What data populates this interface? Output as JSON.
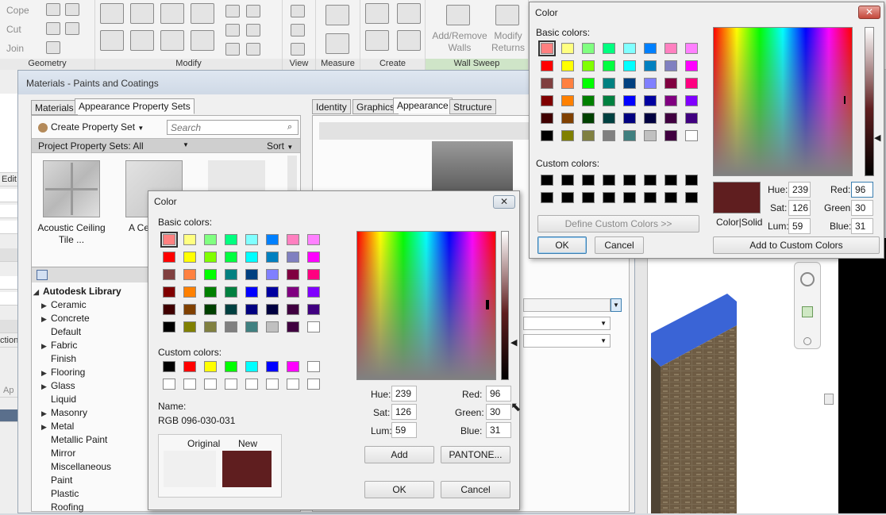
{
  "ribbon": {
    "items": [
      "Cope",
      "Cut",
      "Join"
    ],
    "groups": [
      "Geometry",
      "Modify",
      "View",
      "Measure",
      "Create",
      "Wall Sweep"
    ],
    "wall_sweep_buttons": [
      "Add/Remove Walls",
      "Modify Returns"
    ]
  },
  "left_strip": {
    "labels": [
      "Edit",
      "ction",
      "Ap"
    ]
  },
  "materials": {
    "title": "Materials - Paints and Coatings",
    "left_tabs": [
      "Materials",
      "Appearance Property Sets"
    ],
    "create_set_label": "Create Property Set",
    "search_placeholder": "Search",
    "project_sets": "Project Property Sets: All",
    "sort_label": "Sort",
    "thumbnails": [
      {
        "name": "Acoustic Ceiling Tile ..."
      },
      {
        "name": "A Ceili"
      }
    ],
    "right_tabs": [
      "Identity",
      "Graphics",
      "Appearance",
      "Structure"
    ],
    "library_title": "Autodesk Library",
    "library_items": [
      {
        "label": "Ceramic",
        "expandable": true
      },
      {
        "label": "Concrete",
        "expandable": true
      },
      {
        "label": "Default",
        "expandable": false
      },
      {
        "label": "Fabric",
        "expandable": true
      },
      {
        "label": "Finish",
        "expandable": false
      },
      {
        "label": "Flooring",
        "expandable": true
      },
      {
        "label": "Glass",
        "expandable": true
      },
      {
        "label": "Liquid",
        "expandable": false
      },
      {
        "label": "Masonry",
        "expandable": true
      },
      {
        "label": "Metal",
        "expandable": true
      },
      {
        "label": "Metallic Paint",
        "expandable": false
      },
      {
        "label": "Mirror",
        "expandable": false
      },
      {
        "label": "Miscellaneous",
        "expandable": false
      },
      {
        "label": "Paint",
        "expandable": false
      },
      {
        "label": "Plastic",
        "expandable": false
      },
      {
        "label": "Roofing",
        "expandable": false
      }
    ]
  },
  "basic_colors": [
    [
      "#ff8080",
      "#ffff80",
      "#80ff80",
      "#00ff80",
      "#80ffff",
      "#0080ff",
      "#ff80c0",
      "#ff80ff"
    ],
    [
      "#ff0000",
      "#ffff00",
      "#80ff00",
      "#00ff40",
      "#00ffff",
      "#0080c0",
      "#8080c0",
      "#ff00ff"
    ],
    [
      "#804040",
      "#ff8040",
      "#00ff00",
      "#008080",
      "#004080",
      "#8080ff",
      "#800040",
      "#ff0080"
    ],
    [
      "#800000",
      "#ff8000",
      "#008000",
      "#008040",
      "#0000ff",
      "#0000a0",
      "#800080",
      "#8000ff"
    ],
    [
      "#400000",
      "#804000",
      "#004000",
      "#004040",
      "#000080",
      "#000040",
      "#400040",
      "#400080"
    ],
    [
      "#000000",
      "#808000",
      "#808040",
      "#808080",
      "#408080",
      "#c0c0c0",
      "#400040",
      "#ffffff"
    ]
  ],
  "color_dialog_front": {
    "title": "Color",
    "basic_label": "Basic colors:",
    "custom_label": "Custom colors:",
    "custom_colors": [
      "#000000",
      "#ff0000",
      "#ffff00",
      "#00ff00",
      "#00ffff",
      "#0000ff",
      "#ff00ff",
      "#ffffff",
      "#ffffff",
      "#ffffff",
      "#ffffff",
      "#ffffff",
      "#ffffff",
      "#ffffff",
      "#ffffff",
      "#ffffff"
    ],
    "name_label": "Name:",
    "name_value": "RGB 096-030-031",
    "original_label": "Original",
    "new_label": "New",
    "original_color": "#f0f0f0",
    "new_color": "#5f1e1f",
    "hue_label": "Hue:",
    "hue": "239",
    "sat_label": "Sat:",
    "sat": "126",
    "lum_label": "Lum:",
    "lum": "59",
    "red_label": "Red:",
    "red": "96",
    "green_label": "Green:",
    "green": "30",
    "blue_label": "Blue:",
    "blue": "31",
    "add_label": "Add",
    "pantone_label": "PANTONE...",
    "ok_label": "OK",
    "cancel_label": "Cancel",
    "close_glyph": "✕"
  },
  "color_dialog_back": {
    "title": "Color",
    "basic_label": "Basic colors:",
    "custom_label": "Custom colors:",
    "custom_colors": [
      "#000000",
      "#000000",
      "#000000",
      "#000000",
      "#000000",
      "#000000",
      "#000000",
      "#000000",
      "#000000",
      "#000000",
      "#000000",
      "#000000",
      "#000000",
      "#000000",
      "#000000",
      "#000000"
    ],
    "define_label": "Define Custom Colors >>",
    "ok_label": "OK",
    "cancel_label": "Cancel",
    "colorsolid_label": "Color|Solid",
    "solid_color": "#5f1e1f",
    "hue_label": "Hue:",
    "hue": "239",
    "sat_label": "Sat:",
    "sat": "126",
    "lum_label": "Lum:",
    "lum": "59",
    "red_label": "Red:",
    "red": "96",
    "green_label": "Green:",
    "green": "30",
    "blue_label": "Blue:",
    "blue": "31",
    "add_custom_label": "Add to Custom Colors",
    "close_glyph": "✕"
  }
}
